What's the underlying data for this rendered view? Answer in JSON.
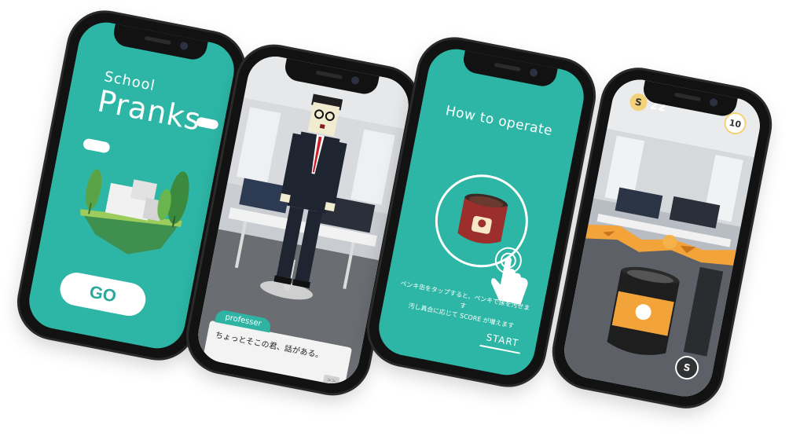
{
  "phone1": {
    "title_small": "School",
    "title_large": "Pranks",
    "go_label": "GO"
  },
  "phone2": {
    "speaker": "professer",
    "dialog_text": "ちょっとそこの君、話がある。",
    "next_label": ">>"
  },
  "phone3": {
    "title": "How to operate",
    "instruction_line1": "ペンキ缶をタップすると、ペンキで床を汚せます",
    "instruction_line2": "汚し具合に応じて SCORE が増えます",
    "start_label": "START"
  },
  "phone4": {
    "score_icon": "S",
    "score": "22",
    "level": "10",
    "skip_icon": "S"
  },
  "colors": {
    "teal": "#2db6a6",
    "paint_orange": "#f2a33a",
    "white": "#ffffff"
  }
}
